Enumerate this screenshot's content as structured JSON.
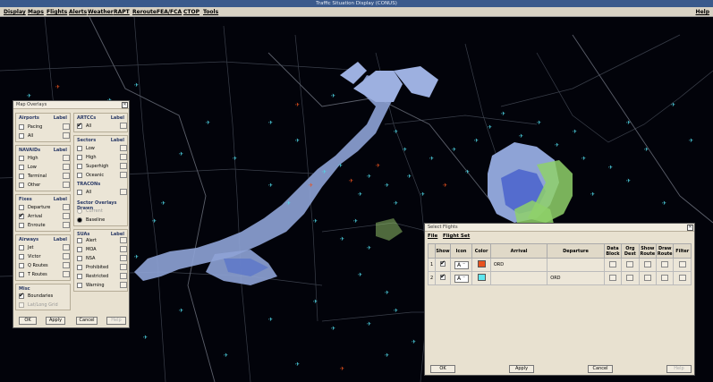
{
  "window": {
    "title": "Traffic Situation Display (CONUS)"
  },
  "menubar": {
    "items": [
      "Display",
      "Maps",
      "Flights",
      "Alerts",
      "Weather",
      "RAPT",
      "Reroute",
      "FEA/FCA",
      "CTOP",
      "Tools"
    ],
    "help": "Help"
  },
  "map_overlays": {
    "title": "Map Overlays",
    "airports": {
      "title": "Airports",
      "label": "Label",
      "items": [
        {
          "name": "Pacing",
          "checked": false
        },
        {
          "name": "All",
          "checked": false
        }
      ]
    },
    "navaids": {
      "title": "NAVAIDs",
      "label": "Label",
      "items": [
        {
          "name": "High",
          "checked": false
        },
        {
          "name": "Low",
          "checked": false
        },
        {
          "name": "Terminal",
          "checked": false
        },
        {
          "name": "Other",
          "checked": false
        }
      ]
    },
    "fixes": {
      "title": "Fixes",
      "label": "Label",
      "items": [
        {
          "name": "Departure",
          "checked": false
        },
        {
          "name": "Arrival",
          "checked": true
        },
        {
          "name": "Enroute",
          "checked": false
        }
      ]
    },
    "airways": {
      "title": "Airways",
      "label": "Label",
      "items": [
        {
          "name": "Jet",
          "checked": false
        },
        {
          "name": "Victor",
          "checked": false
        },
        {
          "name": "Q Routes",
          "checked": false
        },
        {
          "name": "T Routes",
          "checked": false
        }
      ]
    },
    "misc": {
      "title": "Misc",
      "items": [
        {
          "name": "Boundaries",
          "checked": true
        },
        {
          "name": "Lat/Long Grid",
          "checked": false
        }
      ]
    },
    "artccs": {
      "title": "ARTCCs",
      "label": "Label",
      "items": [
        {
          "name": "All",
          "checked": true
        }
      ]
    },
    "sectors": {
      "title": "Sectors",
      "label": "Label",
      "items": [
        {
          "name": "Low",
          "checked": false
        },
        {
          "name": "High",
          "checked": false
        },
        {
          "name": "Superhigh",
          "checked": false
        },
        {
          "name": "Oceanic",
          "checked": false
        }
      ]
    },
    "tracons": {
      "title": "TRACONs",
      "items": [
        {
          "name": "All",
          "checked": false
        }
      ]
    },
    "sector_overlays": {
      "title": "Sector Overlays Drawn",
      "options": [
        {
          "name": "Current",
          "selected": false
        },
        {
          "name": "Baseline",
          "selected": true
        }
      ]
    },
    "suas": {
      "title": "SUAs",
      "label": "Label",
      "items": [
        {
          "name": "Alert",
          "checked": false
        },
        {
          "name": "MOA",
          "checked": false
        },
        {
          "name": "NSA",
          "checked": false
        },
        {
          "name": "Prohibited",
          "checked": false
        },
        {
          "name": "Restricted",
          "checked": false
        },
        {
          "name": "Warning",
          "checked": false
        }
      ]
    },
    "buttons": {
      "ok": "OK",
      "apply": "Apply",
      "cancel": "Cancel",
      "help": "Help"
    }
  },
  "select_flights": {
    "title": "Select Flights",
    "menu": {
      "file": "File",
      "flight_set": "Flight Set"
    },
    "columns": [
      "",
      "Show",
      "Icon",
      "Color",
      "Arrival",
      "Departure",
      "Data Block",
      "Org Dest",
      "Show Route",
      "Draw Route",
      "Filter"
    ],
    "rows": [
      {
        "num": "1",
        "show": true,
        "icon": "A",
        "color": "#e8521e",
        "arrival": "ORD",
        "departure": ""
      },
      {
        "num": "2",
        "show": true,
        "icon": "A",
        "color": "#5fe6ee",
        "arrival": "",
        "departure": "ORD"
      }
    ],
    "buttons": {
      "ok": "OK",
      "apply": "Apply",
      "cancel": "Cancel",
      "help": "Help"
    }
  }
}
